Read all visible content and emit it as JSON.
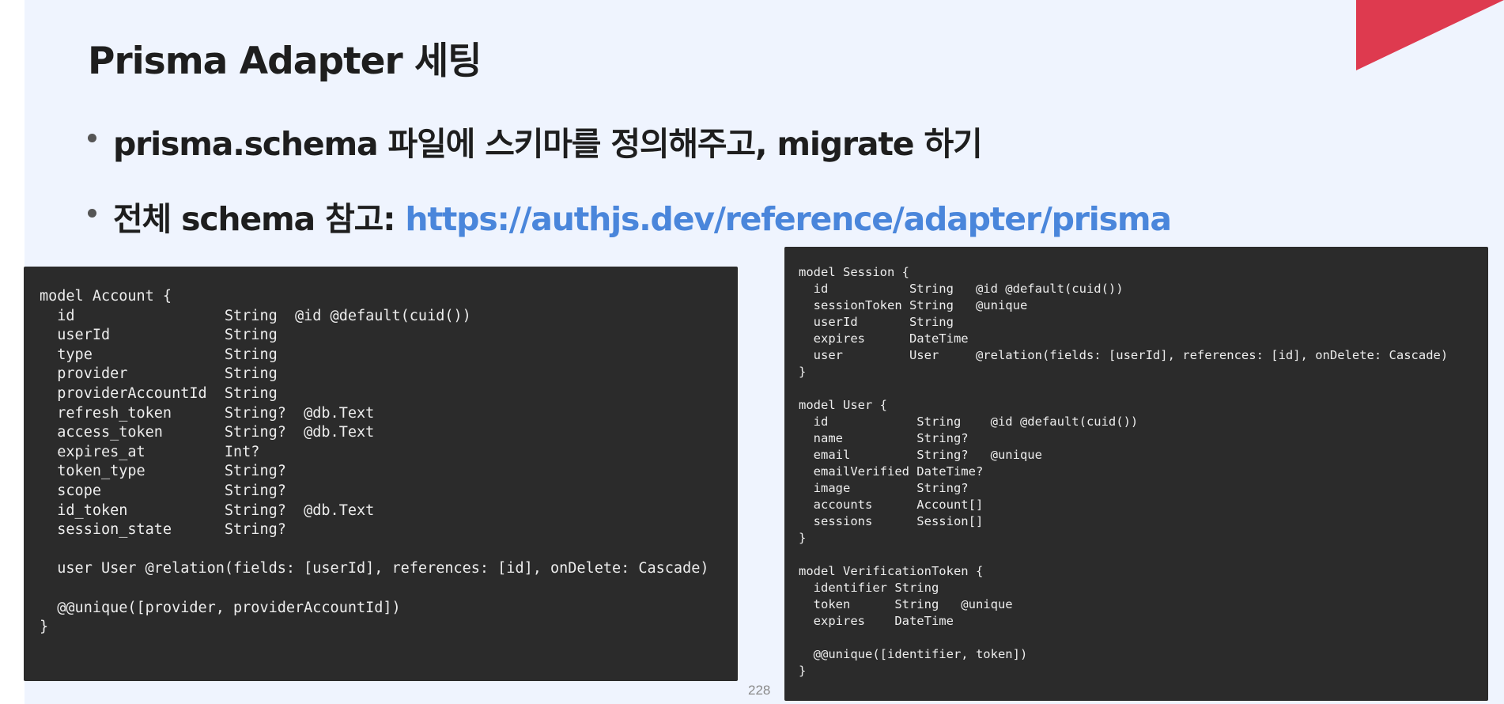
{
  "slide": {
    "title": "Prisma Adapter 세팅",
    "bullets": [
      {
        "text": "prisma.schema 파일에 스키마를 정의해주고, migrate 하기"
      },
      {
        "text": "전체 schema 참고: ",
        "link": "https://authjs.dev/reference/adapter/prisma"
      }
    ],
    "page_number": "228",
    "accent_color": "#de3a4f",
    "link_color": "#4a86db"
  },
  "code_blocks": {
    "account_model": "model Account {\n  id                 String  @id @default(cuid())\n  userId             String\n  type               String\n  provider           String\n  providerAccountId  String\n  refresh_token      String?  @db.Text\n  access_token       String?  @db.Text\n  expires_at         Int?\n  token_type         String?\n  scope              String?\n  id_token           String?  @db.Text\n  session_state      String?\n\n  user User @relation(fields: [userId], references: [id], onDelete: Cascade)\n\n  @@unique([provider, providerAccountId])\n}",
    "session_user_models": "model Session {\n  id           String   @id @default(cuid())\n  sessionToken String   @unique\n  userId       String\n  expires      DateTime\n  user         User     @relation(fields: [userId], references: [id], onDelete: Cascade)\n}\n\nmodel User {\n  id            String    @id @default(cuid())\n  name          String?\n  email         String?   @unique\n  emailVerified DateTime?\n  image         String?\n  accounts      Account[]\n  sessions      Session[]\n}\n\nmodel VerificationToken {\n  identifier String\n  token      String   @unique\n  expires    DateTime\n\n  @@unique([identifier, token])\n}"
  }
}
